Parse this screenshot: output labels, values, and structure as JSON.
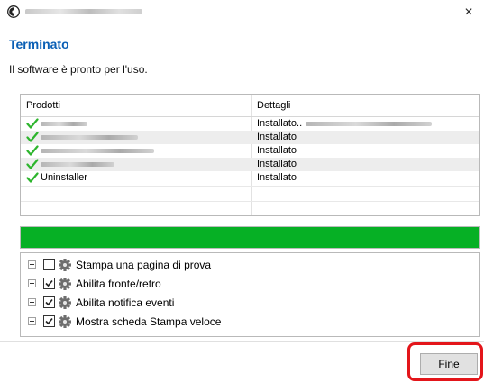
{
  "window": {
    "close_glyph": "×"
  },
  "header": {
    "title": "Terminato",
    "subtitle": "Il software è pronto per l'uso."
  },
  "table": {
    "columns": [
      "Prodotti",
      "Dettagli"
    ],
    "rows": [
      {
        "product": "",
        "details": "Installato..",
        "status_icon": "check-icon"
      },
      {
        "product": "",
        "details": "Installato",
        "status_icon": "check-icon"
      },
      {
        "product": "",
        "details": "Installato",
        "status_icon": "check-icon"
      },
      {
        "product": "",
        "details": "Installato",
        "status_icon": "check-icon"
      },
      {
        "product": "Uninstaller",
        "details": "Installato",
        "status_icon": "check-icon"
      }
    ]
  },
  "progress": {
    "fraction": 1.0,
    "color": "#06b025"
  },
  "options": [
    {
      "label": "Stampa una pagina di prova",
      "checked": false,
      "icon": "gear-icon"
    },
    {
      "label": "Abilita fronte/retro",
      "checked": true,
      "icon": "gear-icon"
    },
    {
      "label": "Abilita notifica eventi",
      "checked": true,
      "icon": "gear-icon"
    },
    {
      "label": "Mostra scheda Stampa veloce",
      "checked": true,
      "icon": "gear-icon"
    }
  ],
  "footer": {
    "finish_label": "Fine",
    "highlight_color": "#e3151a"
  },
  "colors": {
    "heading": "#0a5fb5",
    "check": "#2db52d"
  }
}
